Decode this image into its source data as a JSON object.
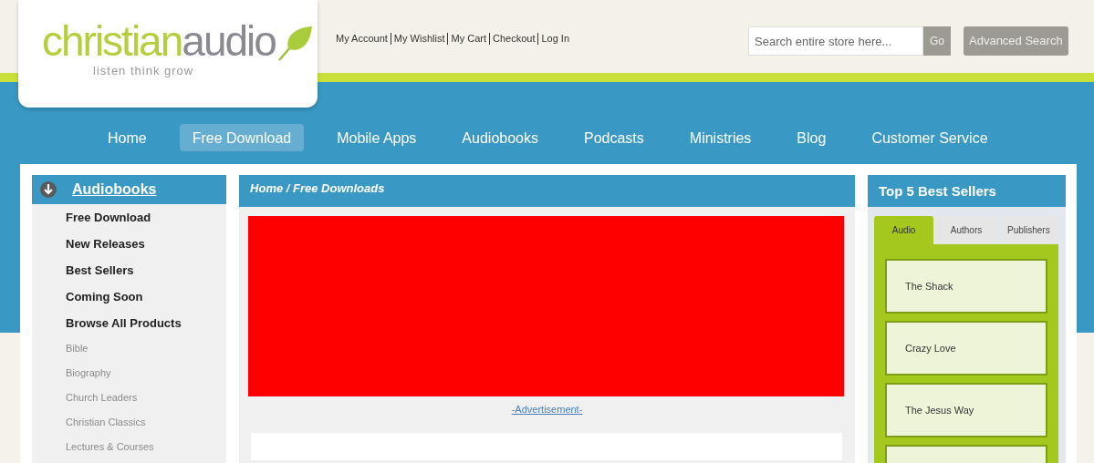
{
  "logo": {
    "parts": [
      {
        "text": "christian",
        "kind": "light"
      },
      {
        "text": "audio",
        "kind": "dark"
      }
    ],
    "tagline": "listen think grow"
  },
  "account_links": [
    "My Account",
    "My Wishlist",
    "My Cart",
    "Checkout",
    "Log In"
  ],
  "search": {
    "placeholder": "Search entire store here...",
    "go_button": "Go",
    "advanced_button": "Advanced Search"
  },
  "nav": [
    {
      "label": "Home",
      "selected": false
    },
    {
      "label": "Free Download",
      "selected": true
    },
    {
      "label": "Mobile Apps",
      "selected": false
    },
    {
      "label": "Audiobooks",
      "selected": false
    },
    {
      "label": "Podcasts",
      "selected": false
    },
    {
      "label": "Ministries",
      "selected": false
    },
    {
      "label": "Blog",
      "selected": false
    },
    {
      "label": "Customer Service",
      "selected": false
    }
  ],
  "sidebar": {
    "title": "Audiobooks",
    "items": [
      {
        "label": "Free Download",
        "kind": "main"
      },
      {
        "label": "New Releases",
        "kind": "main"
      },
      {
        "label": "Best Sellers",
        "kind": "main"
      },
      {
        "label": "Coming Soon",
        "kind": "main"
      },
      {
        "label": "Browse All Products",
        "kind": "main"
      },
      {
        "label": "Bible",
        "kind": "category"
      },
      {
        "label": "Biography",
        "kind": "category"
      },
      {
        "label": "Church Leaders",
        "kind": "category"
      },
      {
        "label": "Christian Classics",
        "kind": "category"
      },
      {
        "label": "Lectures & Courses",
        "kind": "category"
      }
    ]
  },
  "main": {
    "breadcrumb": "Home / Free Downloads",
    "ad_caption": "-Advertisement-"
  },
  "best_sellers": {
    "title": "Top 5 Best Sellers",
    "tabs": [
      {
        "label": "Audio",
        "selected": true
      },
      {
        "label": "Authors",
        "selected": false
      },
      {
        "label": "Publishers",
        "selected": false
      }
    ],
    "items": [
      "The Shack",
      "Crazy Love",
      "The Jesus Way"
    ]
  }
}
